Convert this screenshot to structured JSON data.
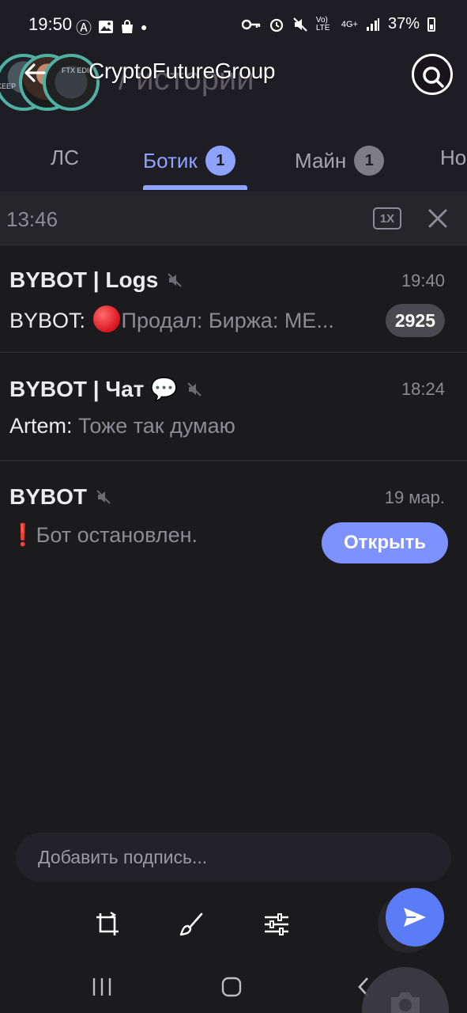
{
  "status_bar": {
    "time": "19:50",
    "battery_percent": "37%",
    "icons_left": [
      "anarchy-icon",
      "image-icon",
      "bag-icon",
      "dot-icon"
    ],
    "icons_right": [
      "key-icon",
      "alarm-icon",
      "mute-icon",
      "volte-icon",
      "signal-icon",
      "battery-icon"
    ],
    "volte_label": "Vo) LTE",
    "network_label": "4G+"
  },
  "header": {
    "title": "CryptoFutureGroup",
    "ghost_text": "/ истории",
    "avatar_labels": [
      "KEEP",
      "FTX EDI"
    ]
  },
  "tabs": [
    {
      "label": "ЛС",
      "badge": "",
      "active": false
    },
    {
      "label": "Ботик",
      "badge": "1",
      "active": true
    },
    {
      "label": "Майн",
      "badge": "1",
      "active": false
    },
    {
      "label": "Но",
      "badge": "",
      "active": false
    }
  ],
  "audio_bar": {
    "time": "13:46",
    "speed": "1X"
  },
  "chats": [
    {
      "name": "BYBOT | Logs",
      "time": "19:40",
      "sender": "BYBOT:",
      "preview": "Продал:  Биржа: ME...",
      "unread": "2925",
      "muted": true
    },
    {
      "name": "BYBOT | Чат 💬",
      "time": "18:24",
      "sender": "Artem:",
      "preview": "Тоже так думаю",
      "unread": "",
      "muted": true
    },
    {
      "name": "BYBOT",
      "time": "19 мар.",
      "sender": "",
      "preview": "Бот остановлен.",
      "action_label": "Открыть",
      "muted": true
    }
  ],
  "caption": {
    "placeholder": "Добавить подпись..."
  },
  "colors": {
    "accent": "#8ea2ff",
    "send": "#5b7cf7",
    "background": "#1b1b1d",
    "header_bg": "#1f1d24"
  }
}
